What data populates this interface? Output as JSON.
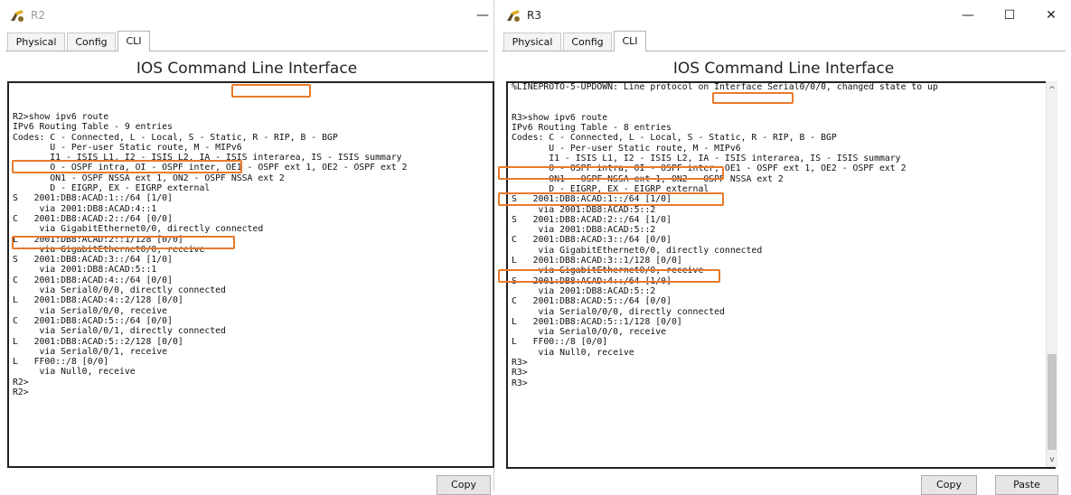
{
  "r2": {
    "title": "R2",
    "tabs": [
      "Physical",
      "Config",
      "CLI"
    ],
    "panel_title": "IOS Command Line Interface",
    "console": "R2>show ipv6 route\nIPv6 Routing Table - 9 entries\nCodes: C - Connected, L - Local, S - Static, R - RIP, B - BGP\n       U - Per-user Static route, M - MIPv6\n       I1 - ISIS L1, I2 - ISIS L2, IA - ISIS interarea, IS - ISIS summary\n       O - OSPF intra, OI - OSPF inter, OE1 - OSPF ext 1, OE2 - OSPF ext 2\n       ON1 - OSPF NSSA ext 1, ON2 - OSPF NSSA ext 2\n       D - EIGRP, EX - EIGRP external\nS   2001:DB8:ACAD:1::/64 [1/0]\n     via 2001:DB8:ACAD:4::1\nC   2001:DB8:ACAD:2::/64 [0/0]\n     via GigabitEthernet0/0, directly connected\nL   2001:DB8:ACAD:2::1/128 [0/0]\n     via GigabitEthernet0/0, receive\nS   2001:DB8:ACAD:3::/64 [1/0]\n     via 2001:DB8:ACAD:5::1\nC   2001:DB8:ACAD:4::/64 [0/0]\n     via Serial0/0/0, directly connected\nL   2001:DB8:ACAD:4::2/128 [0/0]\n     via Serial0/0/0, receive\nC   2001:DB8:ACAD:5::/64 [0/0]\n     via Serial0/0/1, directly connected\nL   2001:DB8:ACAD:5::2/128 [0/0]\n     via Serial0/0/1, receive\nL   FF00::/8 [0/0]\n     via Null0, receive\nR2>\nR2>",
    "copy_label": "Copy"
  },
  "r3": {
    "title": "R3",
    "tabs": [
      "Physical",
      "Config",
      "CLI"
    ],
    "panel_title": "IOS Command Line Interface",
    "console": "%LINEPROTO-5-UPDOWN: Line protocol on Interface Serial0/0/0, changed state to up\n\n\nR3>show ipv6 route\nIPv6 Routing Table - 8 entries\nCodes: C - Connected, L - Local, S - Static, R - RIP, B - BGP\n       U - Per-user Static route, M - MIPv6\n       I1 - ISIS L1, I2 - ISIS L2, IA - ISIS interarea, IS - ISIS summary\n       O - OSPF intra, OI - OSPF inter, OE1 - OSPF ext 1, OE2 - OSPF ext 2\n       ON1 - OSPF NSSA ext 1, ON2 - OSPF NSSA ext 2\n       D - EIGRP, EX - EIGRP external\nS   2001:DB8:ACAD:1::/64 [1/0]\n     via 2001:DB8:ACAD:5::2\nS   2001:DB8:ACAD:2::/64 [1/0]\n     via 2001:DB8:ACAD:5::2\nC   2001:DB8:ACAD:3::/64 [0/0]\n     via GigabitEthernet0/0, directly connected\nL   2001:DB8:ACAD:3::1/128 [0/0]\n     via GigabitEthernet0/0, receive\nS   2001:DB8:ACAD:4::/64 [1/0]\n     via 2001:DB8:ACAD:5::2\nC   2001:DB8:ACAD:5::/64 [0/0]\n     via Serial0/0/0, directly connected\nL   2001:DB8:ACAD:5::1/128 [0/0]\n     via Serial0/0/0, receive\nL   FF00::/8 [0/0]\n     via Null0, receive\nR3>\nR3>\nR3>",
    "copy_label": "Copy",
    "paste_label": "Paste",
    "controls": {
      "minimize": "—",
      "maximize": "☐",
      "close": "✕"
    }
  },
  "colors": {
    "highlight": "#e87a2a",
    "console_border": "#222222"
  },
  "icons": {
    "app": "packet-tracer-router-icon"
  }
}
